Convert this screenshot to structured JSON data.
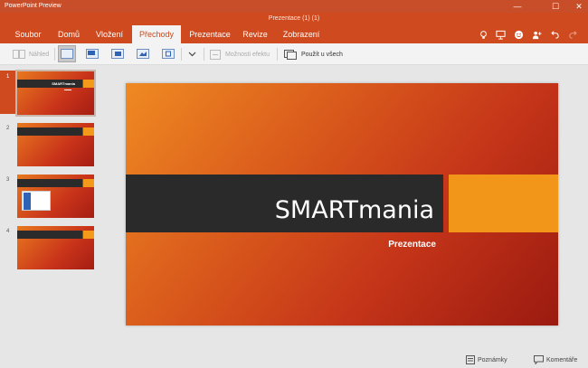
{
  "window": {
    "app_name": "PowerPoint Preview",
    "doc_title": "Prezentace (1) (1)",
    "controls": {
      "minimize": "—",
      "maximize": "☐",
      "close": "✕"
    }
  },
  "ribbon": {
    "tabs": [
      {
        "label": "Soubor",
        "active": false
      },
      {
        "label": "Domů",
        "active": false
      },
      {
        "label": "Vložení",
        "active": false
      },
      {
        "label": "Přechody",
        "active": true
      },
      {
        "label": "Prezentace",
        "active": false
      },
      {
        "label": "Revize",
        "active": false
      },
      {
        "label": "Zobrazení",
        "active": false
      }
    ],
    "accent_color": "#d04a1f"
  },
  "toolbar": {
    "preview_label": "Náhled",
    "effect_options_label": "Možnosti efektu",
    "apply_all_label": "Použít u všech"
  },
  "thumbnails": [
    {
      "number": "1",
      "title": "SMARTmania",
      "active": true
    },
    {
      "number": "2",
      "active": false
    },
    {
      "number": "3",
      "active": false
    },
    {
      "number": "4",
      "active": false
    }
  ],
  "slide": {
    "title": "SMARTmania",
    "subtitle": "Prezentace"
  },
  "statusbar": {
    "notes_label": "Poznámky",
    "comments_label": "Komentáře"
  }
}
